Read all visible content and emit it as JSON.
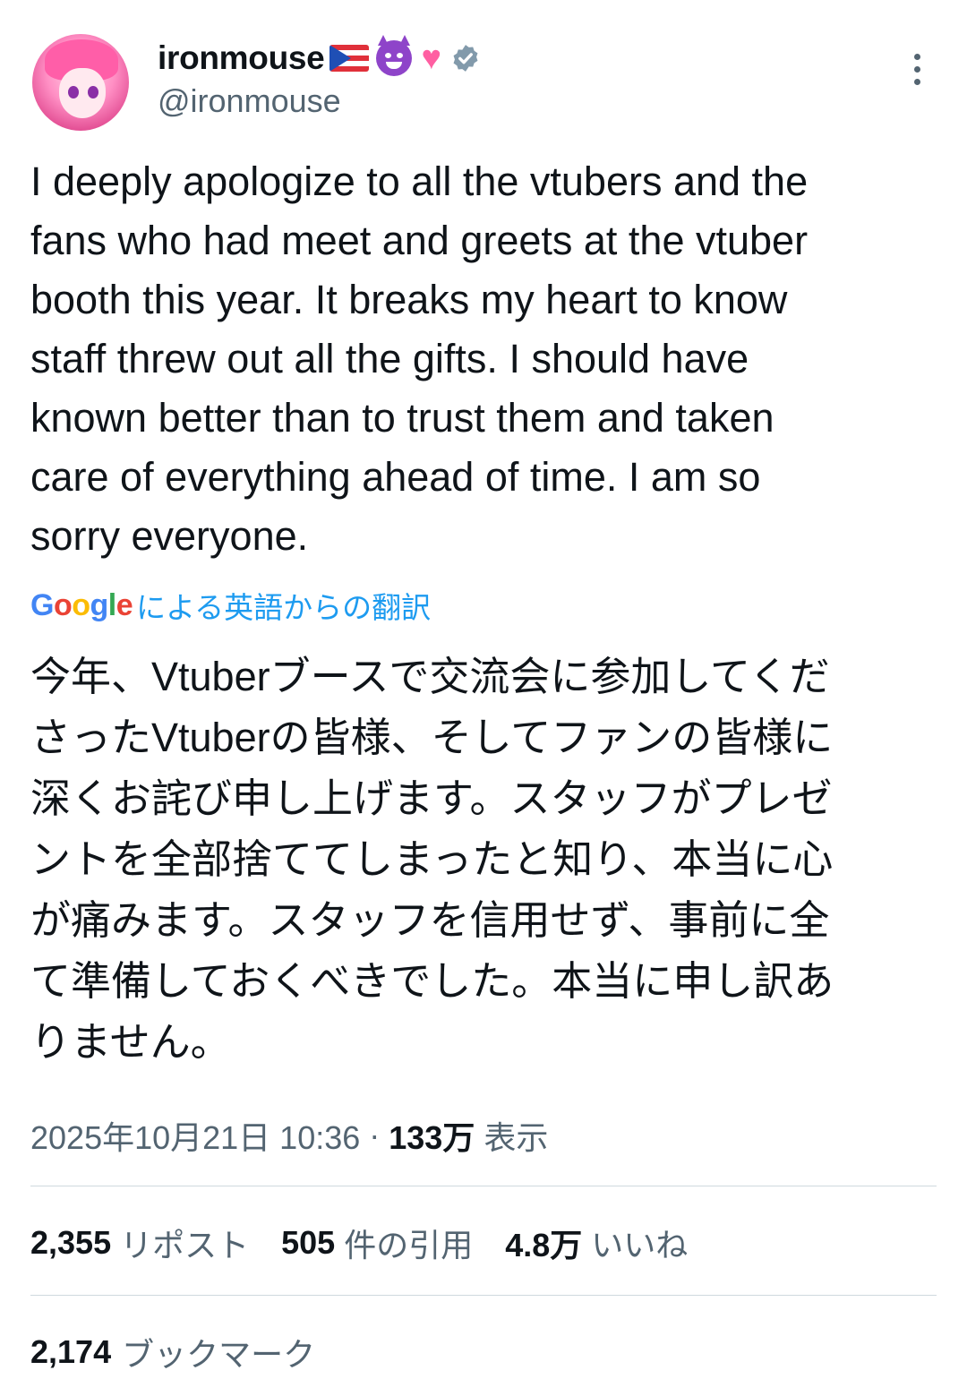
{
  "user": {
    "display_name": "ironmouse",
    "handle": "@ironmouse",
    "emoji_icons": [
      "puerto-rico-flag-icon",
      "smiling-devil-icon",
      "sparkling-heart-icon"
    ],
    "verified": true
  },
  "tweet": {
    "text": "I deeply apologize to all the vtubers and the\nfans who had meet and greets at the vtuber\nbooth this year. It breaks my heart to know\nstaff threw out all the gifts. I should have\nknown better than to trust them and taken\ncare of everything ahead of time. I am so\nsorry everyone.",
    "translation_label": "による英語からの翻訳",
    "translated_text": "今年、Vtuberブースで交流会に参加してくだ\nさったVtuberの皆様、そしてファンの皆様に\n深くお詫び申し上げます。スタッフがプレゼ\nントを全部捨ててしまったと知り、本当に心\nが痛みます。スタッフを信用せず、事前に全\nて準備しておくべきでした。本当に申し訳あ\nりません。"
  },
  "meta": {
    "timestamp": "2025年10月21日 10:36",
    "separator": "·",
    "views_count": "133万",
    "views_label": "表示"
  },
  "stats": {
    "reposts_count": "2,355",
    "reposts_label": "リポスト",
    "quotes_count": "505",
    "quotes_label": "件の引用",
    "likes_count": "4.8万",
    "likes_label": "いいね",
    "bookmarks_count": "2,174",
    "bookmarks_label": "ブックマーク"
  },
  "colors": {
    "text_primary": "#0f1419",
    "text_secondary": "#536471",
    "link_blue": "#1d9bf0",
    "divider": "#cfd9de",
    "verified_badge": "#829aab"
  }
}
